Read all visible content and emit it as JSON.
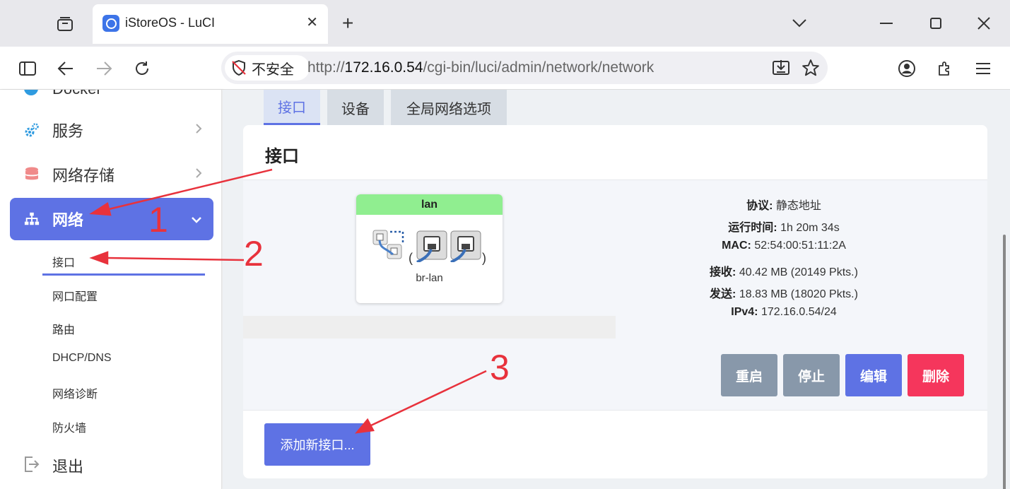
{
  "browser": {
    "tab_title": "iStoreOS - LuCI",
    "security_label": "不安全",
    "url_scheme": "http://",
    "url_host": "172.16.0.54",
    "url_path": "/cgi-bin/luci/admin/network/network"
  },
  "sidebar": {
    "partial_item": "Docker",
    "items": [
      {
        "label": "服务",
        "icon": "gears-icon"
      },
      {
        "label": "网络存储",
        "icon": "database-icon"
      },
      {
        "label": "网络",
        "icon": "network-tree-icon",
        "active": true
      }
    ],
    "subitems": [
      "接口",
      "网口配置",
      "路由",
      "DHCP/DNS",
      "网络诊断",
      "防火墙"
    ],
    "logout": "退出"
  },
  "page_tabs": [
    "接口",
    "设备",
    "全局网络选项"
  ],
  "section_title": "接口",
  "interface": {
    "name": "lan",
    "device": "br-lan",
    "protocol_label": "协议:",
    "protocol": "静态地址",
    "uptime_label": "运行时间:",
    "uptime": "1h 20m 34s",
    "mac_label": "MAC:",
    "mac": "52:54:00:51:11:2A",
    "rx_label": "接收:",
    "rx": "40.42 MB (20149 Pkts.)",
    "tx_label": "发送:",
    "tx": "18.83 MB (18020 Pkts.)",
    "ipv4_label": "IPv4:",
    "ipv4": "172.16.0.54/24"
  },
  "actions": {
    "restart": "重启",
    "stop": "停止",
    "edit": "编辑",
    "delete": "删除"
  },
  "add_interface": "添加新接口...",
  "annotations": [
    "1",
    "2",
    "3"
  ],
  "colors": {
    "accent": "#5e72e4",
    "danger": "#f5365c",
    "neutral": "#8898aa",
    "iface_header": "#90ee90",
    "annotation": "#e8323c"
  }
}
